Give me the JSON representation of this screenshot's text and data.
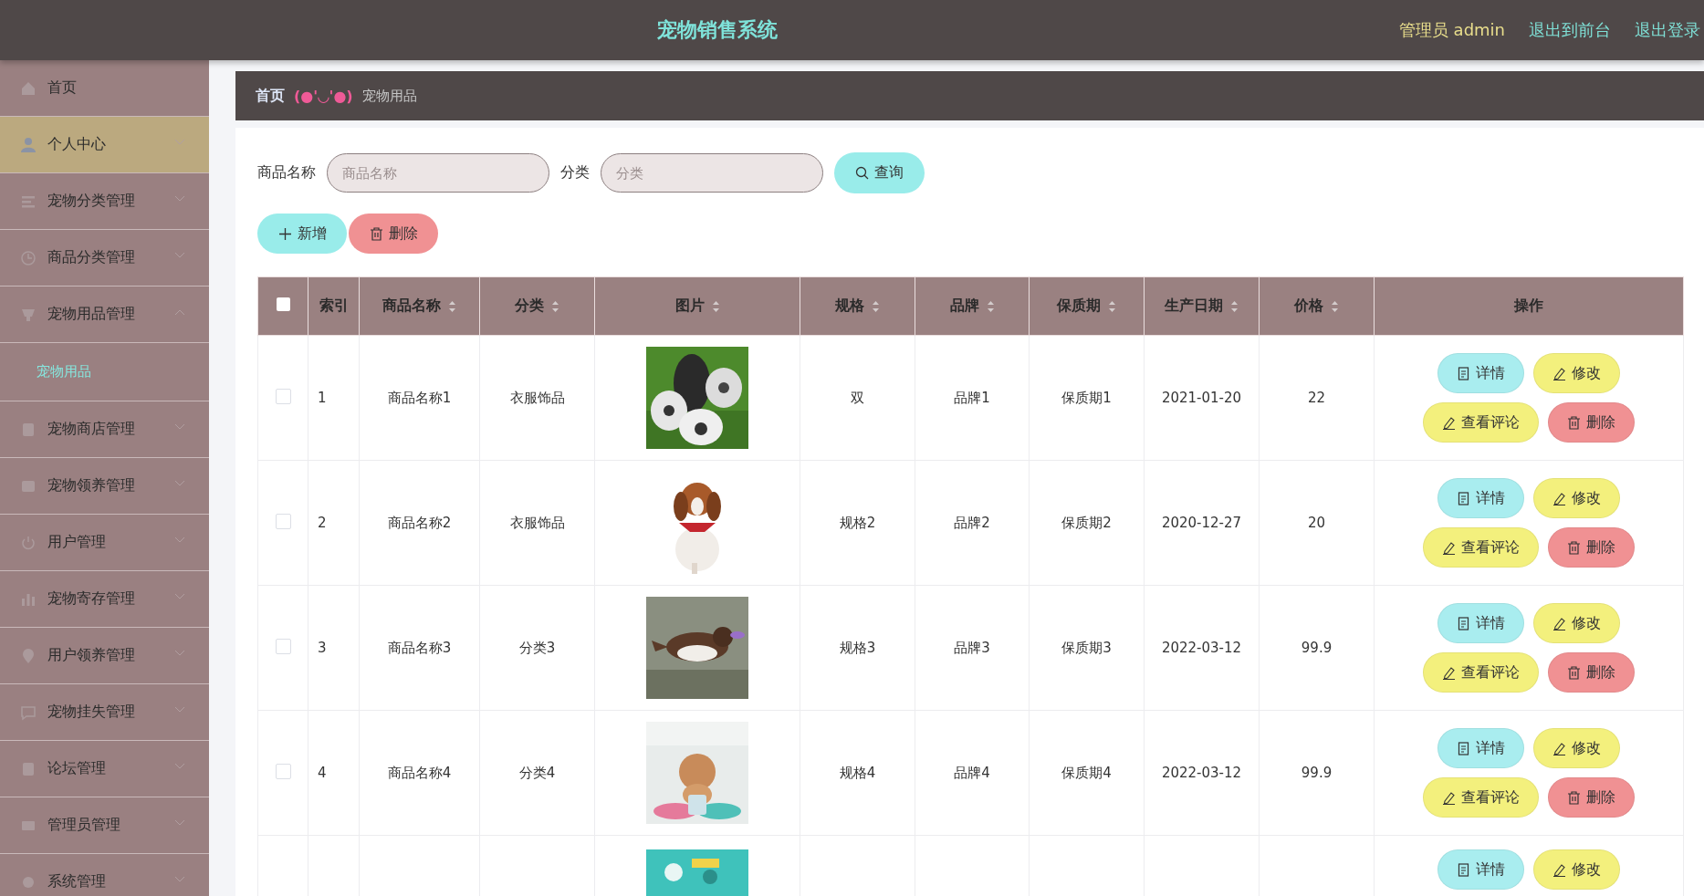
{
  "header": {
    "title": "宠物销售系统",
    "user_label": "管理员 admin",
    "links": [
      "退出到前台",
      "退出登录"
    ]
  },
  "sidebar": {
    "items": [
      {
        "label": "首页",
        "kind": "link",
        "selected": false,
        "expanded": false
      },
      {
        "label": "个人中心",
        "kind": "menu",
        "selected": true,
        "expanded": false
      },
      {
        "label": "宠物分类管理",
        "kind": "menu",
        "selected": false,
        "expanded": false
      },
      {
        "label": "商品分类管理",
        "kind": "menu",
        "selected": false,
        "expanded": false
      },
      {
        "label": "宠物用品管理",
        "kind": "menu",
        "selected": false,
        "expanded": true,
        "children": [
          {
            "label": "宠物用品",
            "selected": true
          }
        ]
      },
      {
        "label": "宠物商店管理",
        "kind": "menu",
        "selected": false,
        "expanded": false
      },
      {
        "label": "宠物领养管理",
        "kind": "menu",
        "selected": false,
        "expanded": false
      },
      {
        "label": "用户管理",
        "kind": "menu",
        "selected": false,
        "expanded": false
      },
      {
        "label": "宠物寄存管理",
        "kind": "menu",
        "selected": false,
        "expanded": false
      },
      {
        "label": "用户领养管理",
        "kind": "menu",
        "selected": false,
        "expanded": false
      },
      {
        "label": "宠物挂失管理",
        "kind": "menu",
        "selected": false,
        "expanded": false
      },
      {
        "label": "论坛管理",
        "kind": "menu",
        "selected": false,
        "expanded": false
      },
      {
        "label": "管理员管理",
        "kind": "menu",
        "selected": false,
        "expanded": false
      },
      {
        "label": "系统管理",
        "kind": "menu",
        "selected": false,
        "expanded": false
      }
    ]
  },
  "breadcrumb": {
    "home": "首页",
    "separator": "(●'◡'●)",
    "current": "宠物用品"
  },
  "search": {
    "fields": [
      {
        "label": "商品名称",
        "placeholder": "商品名称"
      },
      {
        "label": "分类",
        "placeholder": "分类"
      }
    ],
    "button": "查询"
  },
  "actions": [
    {
      "label": "新增",
      "kind": "add"
    },
    {
      "label": "删除",
      "kind": "delete"
    }
  ],
  "table": {
    "columns": [
      {
        "kind": "checkbox",
        "checked": false
      },
      {
        "kind": "text",
        "label": "索引",
        "sortable": false
      },
      {
        "kind": "text",
        "label": "商品名称",
        "sortable": true
      },
      {
        "kind": "text",
        "label": "分类",
        "sortable": true
      },
      {
        "kind": "text",
        "label": "图片",
        "sortable": true
      },
      {
        "kind": "text",
        "label": "规格",
        "sortable": true
      },
      {
        "kind": "text",
        "label": "品牌",
        "sortable": true
      },
      {
        "kind": "text",
        "label": "保质期",
        "sortable": true
      },
      {
        "kind": "text",
        "label": "生产日期",
        "sortable": true
      },
      {
        "kind": "text",
        "label": "价格",
        "sortable": true
      },
      {
        "kind": "text",
        "label": "操作",
        "sortable": false
      }
    ],
    "rows": [
      {
        "checked": false,
        "index": "1",
        "name": "商品名称1",
        "category": "衣服饰品",
        "picture": {
          "kind": "picture"
        },
        "spec": "双",
        "brand": "品牌1",
        "shelf_life": "保质期1",
        "date": "2021-01-20",
        "price": "22",
        "actions": [
          {
            "label": "详情",
            "kind": "detail"
          },
          {
            "label": "修改",
            "kind": "edit"
          },
          {
            "label": "查看评论",
            "kind": "comment"
          },
          {
            "label": "删除",
            "kind": "delete"
          }
        ]
      },
      {
        "checked": false,
        "index": "2",
        "name": "商品名称2",
        "category": "衣服饰品",
        "picture": {
          "kind": "picture"
        },
        "spec": "规格2",
        "brand": "品牌2",
        "shelf_life": "保质期2",
        "date": "2020-12-27",
        "price": "20",
        "actions": [
          {
            "label": "详情",
            "kind": "detail"
          },
          {
            "label": "修改",
            "kind": "edit"
          },
          {
            "label": "查看评论",
            "kind": "comment"
          },
          {
            "label": "删除",
            "kind": "delete"
          }
        ]
      },
      {
        "checked": false,
        "index": "3",
        "name": "商品名称3",
        "category": "分类3",
        "picture": {
          "kind": "picture"
        },
        "spec": "规格3",
        "brand": "品牌3",
        "shelf_life": "保质期3",
        "date": "2022-03-12",
        "price": "99.9",
        "actions": [
          {
            "label": "详情",
            "kind": "detail"
          },
          {
            "label": "修改",
            "kind": "edit"
          },
          {
            "label": "查看评论",
            "kind": "comment"
          },
          {
            "label": "删除",
            "kind": "delete"
          }
        ]
      },
      {
        "checked": false,
        "index": "4",
        "name": "商品名称4",
        "category": "分类4",
        "picture": {
          "kind": "picture"
        },
        "spec": "规格4",
        "brand": "品牌4",
        "shelf_life": "保质期4",
        "date": "2022-03-12",
        "price": "99.9",
        "actions": [
          {
            "label": "详情",
            "kind": "detail"
          },
          {
            "label": "修改",
            "kind": "edit"
          },
          {
            "label": "查看评论",
            "kind": "comment"
          },
          {
            "label": "删除",
            "kind": "delete"
          }
        ]
      },
      {
        "picture": {
          "kind": "picture"
        },
        "actions": [
          {
            "label": "详情",
            "kind": "detail"
          },
          {
            "label": "修改",
            "kind": "edit"
          }
        ]
      }
    ]
  }
}
